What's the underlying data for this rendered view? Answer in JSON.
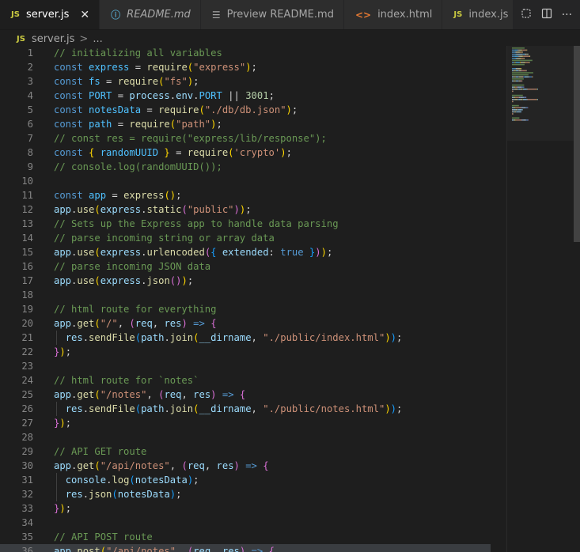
{
  "tabs": [
    {
      "label": "server.js",
      "file_icon": "JS",
      "active": true,
      "italic": false,
      "close": "✕"
    },
    {
      "label": "README.md",
      "file_icon": "ⓘ",
      "active": false,
      "italic": true
    },
    {
      "label": "Preview README.md",
      "file_icon": "☰",
      "active": false,
      "italic": false
    },
    {
      "label": "index.html",
      "file_icon": "<>",
      "active": false,
      "italic": false
    },
    {
      "label": "index.js",
      "file_icon": "JS",
      "active": false,
      "italic": false
    }
  ],
  "tab_actions": {
    "split_icon": "split-editor-icon",
    "more_label": "···"
  },
  "breadcrumb": {
    "file_icon": "JS",
    "file": "server.js",
    "separator": ">",
    "rest": "..."
  },
  "editor": {
    "selected_line": 36,
    "lines": [
      {
        "n": "1",
        "t": [
          [
            "cm",
            "// initializing all variables"
          ]
        ]
      },
      {
        "n": "2",
        "t": [
          [
            "kw",
            "const "
          ],
          [
            "const",
            "express"
          ],
          [
            "pl",
            " = "
          ],
          [
            "fn",
            "require"
          ],
          [
            "p1",
            "("
          ],
          [
            "str",
            "\"express\""
          ],
          [
            "p1",
            ")"
          ],
          [
            "pl",
            ";"
          ]
        ]
      },
      {
        "n": "3",
        "t": [
          [
            "kw",
            "const "
          ],
          [
            "const",
            "fs"
          ],
          [
            "pl",
            " = "
          ],
          [
            "fn",
            "require"
          ],
          [
            "p1",
            "("
          ],
          [
            "str",
            "\"fs\""
          ],
          [
            "p1",
            ")"
          ],
          [
            "pl",
            ";"
          ]
        ]
      },
      {
        "n": "4",
        "t": [
          [
            "kw",
            "const "
          ],
          [
            "const",
            "PORT"
          ],
          [
            "pl",
            " = "
          ],
          [
            "var",
            "process"
          ],
          [
            "pl",
            "."
          ],
          [
            "var",
            "env"
          ],
          [
            "pl",
            "."
          ],
          [
            "const",
            "PORT"
          ],
          [
            "pl",
            " || "
          ],
          [
            "num",
            "3001"
          ],
          [
            "pl",
            ";"
          ]
        ]
      },
      {
        "n": "5",
        "t": [
          [
            "kw",
            "const "
          ],
          [
            "const",
            "notesData"
          ],
          [
            "pl",
            " = "
          ],
          [
            "fn",
            "require"
          ],
          [
            "p1",
            "("
          ],
          [
            "str",
            "\"./db/db.json\""
          ],
          [
            "p1",
            ")"
          ],
          [
            "pl",
            ";"
          ]
        ]
      },
      {
        "n": "6",
        "t": [
          [
            "kw",
            "const "
          ],
          [
            "const",
            "path"
          ],
          [
            "pl",
            " = "
          ],
          [
            "fn",
            "require"
          ],
          [
            "p1",
            "("
          ],
          [
            "str",
            "\"path\""
          ],
          [
            "p1",
            ")"
          ],
          [
            "pl",
            ";"
          ]
        ]
      },
      {
        "n": "7",
        "t": [
          [
            "cm",
            "// const res = require(\"express/lib/response\");"
          ]
        ]
      },
      {
        "n": "8",
        "t": [
          [
            "kw",
            "const "
          ],
          [
            "p1",
            "{ "
          ],
          [
            "const",
            "randomUUID"
          ],
          [
            "p1",
            " }"
          ],
          [
            "pl",
            " = "
          ],
          [
            "fn",
            "require"
          ],
          [
            "p1",
            "("
          ],
          [
            "str",
            "'crypto'"
          ],
          [
            "p1",
            ")"
          ],
          [
            "pl",
            ";"
          ]
        ]
      },
      {
        "n": "9",
        "t": [
          [
            "cm",
            "// console.log(randomUUID());"
          ]
        ]
      },
      {
        "n": "10",
        "t": []
      },
      {
        "n": "11",
        "t": [
          [
            "kw",
            "const "
          ],
          [
            "const",
            "app"
          ],
          [
            "pl",
            " = "
          ],
          [
            "fn",
            "express"
          ],
          [
            "p1",
            "()"
          ],
          [
            "pl",
            ";"
          ]
        ]
      },
      {
        "n": "12",
        "t": [
          [
            "var",
            "app"
          ],
          [
            "pl",
            "."
          ],
          [
            "fn",
            "use"
          ],
          [
            "p1",
            "("
          ],
          [
            "var",
            "express"
          ],
          [
            "pl",
            "."
          ],
          [
            "fn",
            "static"
          ],
          [
            "p2",
            "("
          ],
          [
            "str",
            "\"public\""
          ],
          [
            "p2",
            ")"
          ],
          [
            "p1",
            ")"
          ],
          [
            "pl",
            ";"
          ]
        ]
      },
      {
        "n": "13",
        "t": [
          [
            "cm",
            "// Sets up the Express app to handle data parsing"
          ]
        ]
      },
      {
        "n": "14",
        "t": [
          [
            "cm",
            "// parse incoming string or array data"
          ]
        ]
      },
      {
        "n": "15",
        "t": [
          [
            "var",
            "app"
          ],
          [
            "pl",
            "."
          ],
          [
            "fn",
            "use"
          ],
          [
            "p1",
            "("
          ],
          [
            "var",
            "express"
          ],
          [
            "pl",
            "."
          ],
          [
            "fn",
            "urlencoded"
          ],
          [
            "p2",
            "("
          ],
          [
            "p3",
            "{ "
          ],
          [
            "var",
            "extended"
          ],
          [
            "pl",
            ": "
          ],
          [
            "kw",
            "true"
          ],
          [
            "p3",
            " }"
          ],
          [
            "p2",
            ")"
          ],
          [
            "p1",
            ")"
          ],
          [
            "pl",
            ";"
          ]
        ]
      },
      {
        "n": "16",
        "t": [
          [
            "cm",
            "// parse incoming JSON data"
          ]
        ]
      },
      {
        "n": "17",
        "t": [
          [
            "var",
            "app"
          ],
          [
            "pl",
            "."
          ],
          [
            "fn",
            "use"
          ],
          [
            "p1",
            "("
          ],
          [
            "var",
            "express"
          ],
          [
            "pl",
            "."
          ],
          [
            "fn",
            "json"
          ],
          [
            "p2",
            "()"
          ],
          [
            "p1",
            ")"
          ],
          [
            "pl",
            ";"
          ]
        ]
      },
      {
        "n": "18",
        "t": []
      },
      {
        "n": "19",
        "t": [
          [
            "cm",
            "// html route for everything"
          ]
        ]
      },
      {
        "n": "20",
        "t": [
          [
            "var",
            "app"
          ],
          [
            "pl",
            "."
          ],
          [
            "fn",
            "get"
          ],
          [
            "p1",
            "("
          ],
          [
            "str",
            "\"/\""
          ],
          [
            "pl",
            ", "
          ],
          [
            "p2",
            "("
          ],
          [
            "var",
            "req"
          ],
          [
            "pl",
            ", "
          ],
          [
            "var",
            "res"
          ],
          [
            "p2",
            ")"
          ],
          [
            "kw",
            " => "
          ],
          [
            "p2",
            "{"
          ]
        ]
      },
      {
        "n": "21",
        "g": true,
        "t": [
          [
            "pl",
            "  "
          ],
          [
            "var",
            "res"
          ],
          [
            "pl",
            "."
          ],
          [
            "fn",
            "sendFile"
          ],
          [
            "p3",
            "("
          ],
          [
            "var",
            "path"
          ],
          [
            "pl",
            "."
          ],
          [
            "fn",
            "join"
          ],
          [
            "p1",
            "("
          ],
          [
            "var",
            "__dirname"
          ],
          [
            "pl",
            ", "
          ],
          [
            "str",
            "\"./public/index.html\""
          ],
          [
            "p1",
            ")"
          ],
          [
            "p3",
            ")"
          ],
          [
            "pl",
            ";"
          ]
        ]
      },
      {
        "n": "22",
        "t": [
          [
            "p2",
            "}"
          ],
          [
            "p1",
            ")"
          ],
          [
            "pl",
            ";"
          ]
        ]
      },
      {
        "n": "23",
        "t": []
      },
      {
        "n": "24",
        "t": [
          [
            "cm",
            "// html route for `notes`"
          ]
        ]
      },
      {
        "n": "25",
        "t": [
          [
            "var",
            "app"
          ],
          [
            "pl",
            "."
          ],
          [
            "fn",
            "get"
          ],
          [
            "p1",
            "("
          ],
          [
            "str",
            "\"/notes\""
          ],
          [
            "pl",
            ", "
          ],
          [
            "p2",
            "("
          ],
          [
            "var",
            "req"
          ],
          [
            "pl",
            ", "
          ],
          [
            "var",
            "res"
          ],
          [
            "p2",
            ")"
          ],
          [
            "kw",
            " => "
          ],
          [
            "p2",
            "{"
          ]
        ]
      },
      {
        "n": "26",
        "g": true,
        "t": [
          [
            "pl",
            "  "
          ],
          [
            "var",
            "res"
          ],
          [
            "pl",
            "."
          ],
          [
            "fn",
            "sendFile"
          ],
          [
            "p3",
            "("
          ],
          [
            "var",
            "path"
          ],
          [
            "pl",
            "."
          ],
          [
            "fn",
            "join"
          ],
          [
            "p1",
            "("
          ],
          [
            "var",
            "__dirname"
          ],
          [
            "pl",
            ", "
          ],
          [
            "str",
            "\"./public/notes.html\""
          ],
          [
            "p1",
            ")"
          ],
          [
            "p3",
            ")"
          ],
          [
            "pl",
            ";"
          ]
        ]
      },
      {
        "n": "27",
        "t": [
          [
            "p2",
            "}"
          ],
          [
            "p1",
            ")"
          ],
          [
            "pl",
            ";"
          ]
        ]
      },
      {
        "n": "28",
        "t": []
      },
      {
        "n": "29",
        "t": [
          [
            "cm",
            "// API GET route"
          ]
        ]
      },
      {
        "n": "30",
        "t": [
          [
            "var",
            "app"
          ],
          [
            "pl",
            "."
          ],
          [
            "fn",
            "get"
          ],
          [
            "p1",
            "("
          ],
          [
            "str",
            "\"/api/notes\""
          ],
          [
            "pl",
            ", "
          ],
          [
            "p2",
            "("
          ],
          [
            "var",
            "req"
          ],
          [
            "pl",
            ", "
          ],
          [
            "var",
            "res"
          ],
          [
            "p2",
            ")"
          ],
          [
            "kw",
            " => "
          ],
          [
            "p2",
            "{"
          ]
        ]
      },
      {
        "n": "31",
        "g": true,
        "t": [
          [
            "pl",
            "  "
          ],
          [
            "var",
            "console"
          ],
          [
            "pl",
            "."
          ],
          [
            "fn",
            "log"
          ],
          [
            "p3",
            "("
          ],
          [
            "var",
            "notesData"
          ],
          [
            "p3",
            ")"
          ],
          [
            "pl",
            ";"
          ]
        ]
      },
      {
        "n": "32",
        "g": true,
        "t": [
          [
            "pl",
            "  "
          ],
          [
            "var",
            "res"
          ],
          [
            "pl",
            "."
          ],
          [
            "fn",
            "json"
          ],
          [
            "p3",
            "("
          ],
          [
            "var",
            "notesData"
          ],
          [
            "p3",
            ")"
          ],
          [
            "pl",
            ";"
          ]
        ]
      },
      {
        "n": "33",
        "t": [
          [
            "p2",
            "}"
          ],
          [
            "p1",
            ")"
          ],
          [
            "pl",
            ";"
          ]
        ]
      },
      {
        "n": "34",
        "t": []
      },
      {
        "n": "35",
        "t": [
          [
            "cm",
            "// API POST route"
          ]
        ]
      },
      {
        "n": "36",
        "t": [
          [
            "var",
            "app"
          ],
          [
            "pl",
            "."
          ],
          [
            "fn",
            "post"
          ],
          [
            "p1",
            "("
          ],
          [
            "str",
            "\"/api/notes\""
          ],
          [
            "pl",
            ", "
          ],
          [
            "p2",
            "("
          ],
          [
            "var",
            "req"
          ],
          [
            "pl",
            ", "
          ],
          [
            "var",
            "res"
          ],
          [
            "p2",
            ")"
          ],
          [
            "kw",
            " => "
          ],
          [
            "p2",
            "{"
          ]
        ]
      }
    ]
  }
}
